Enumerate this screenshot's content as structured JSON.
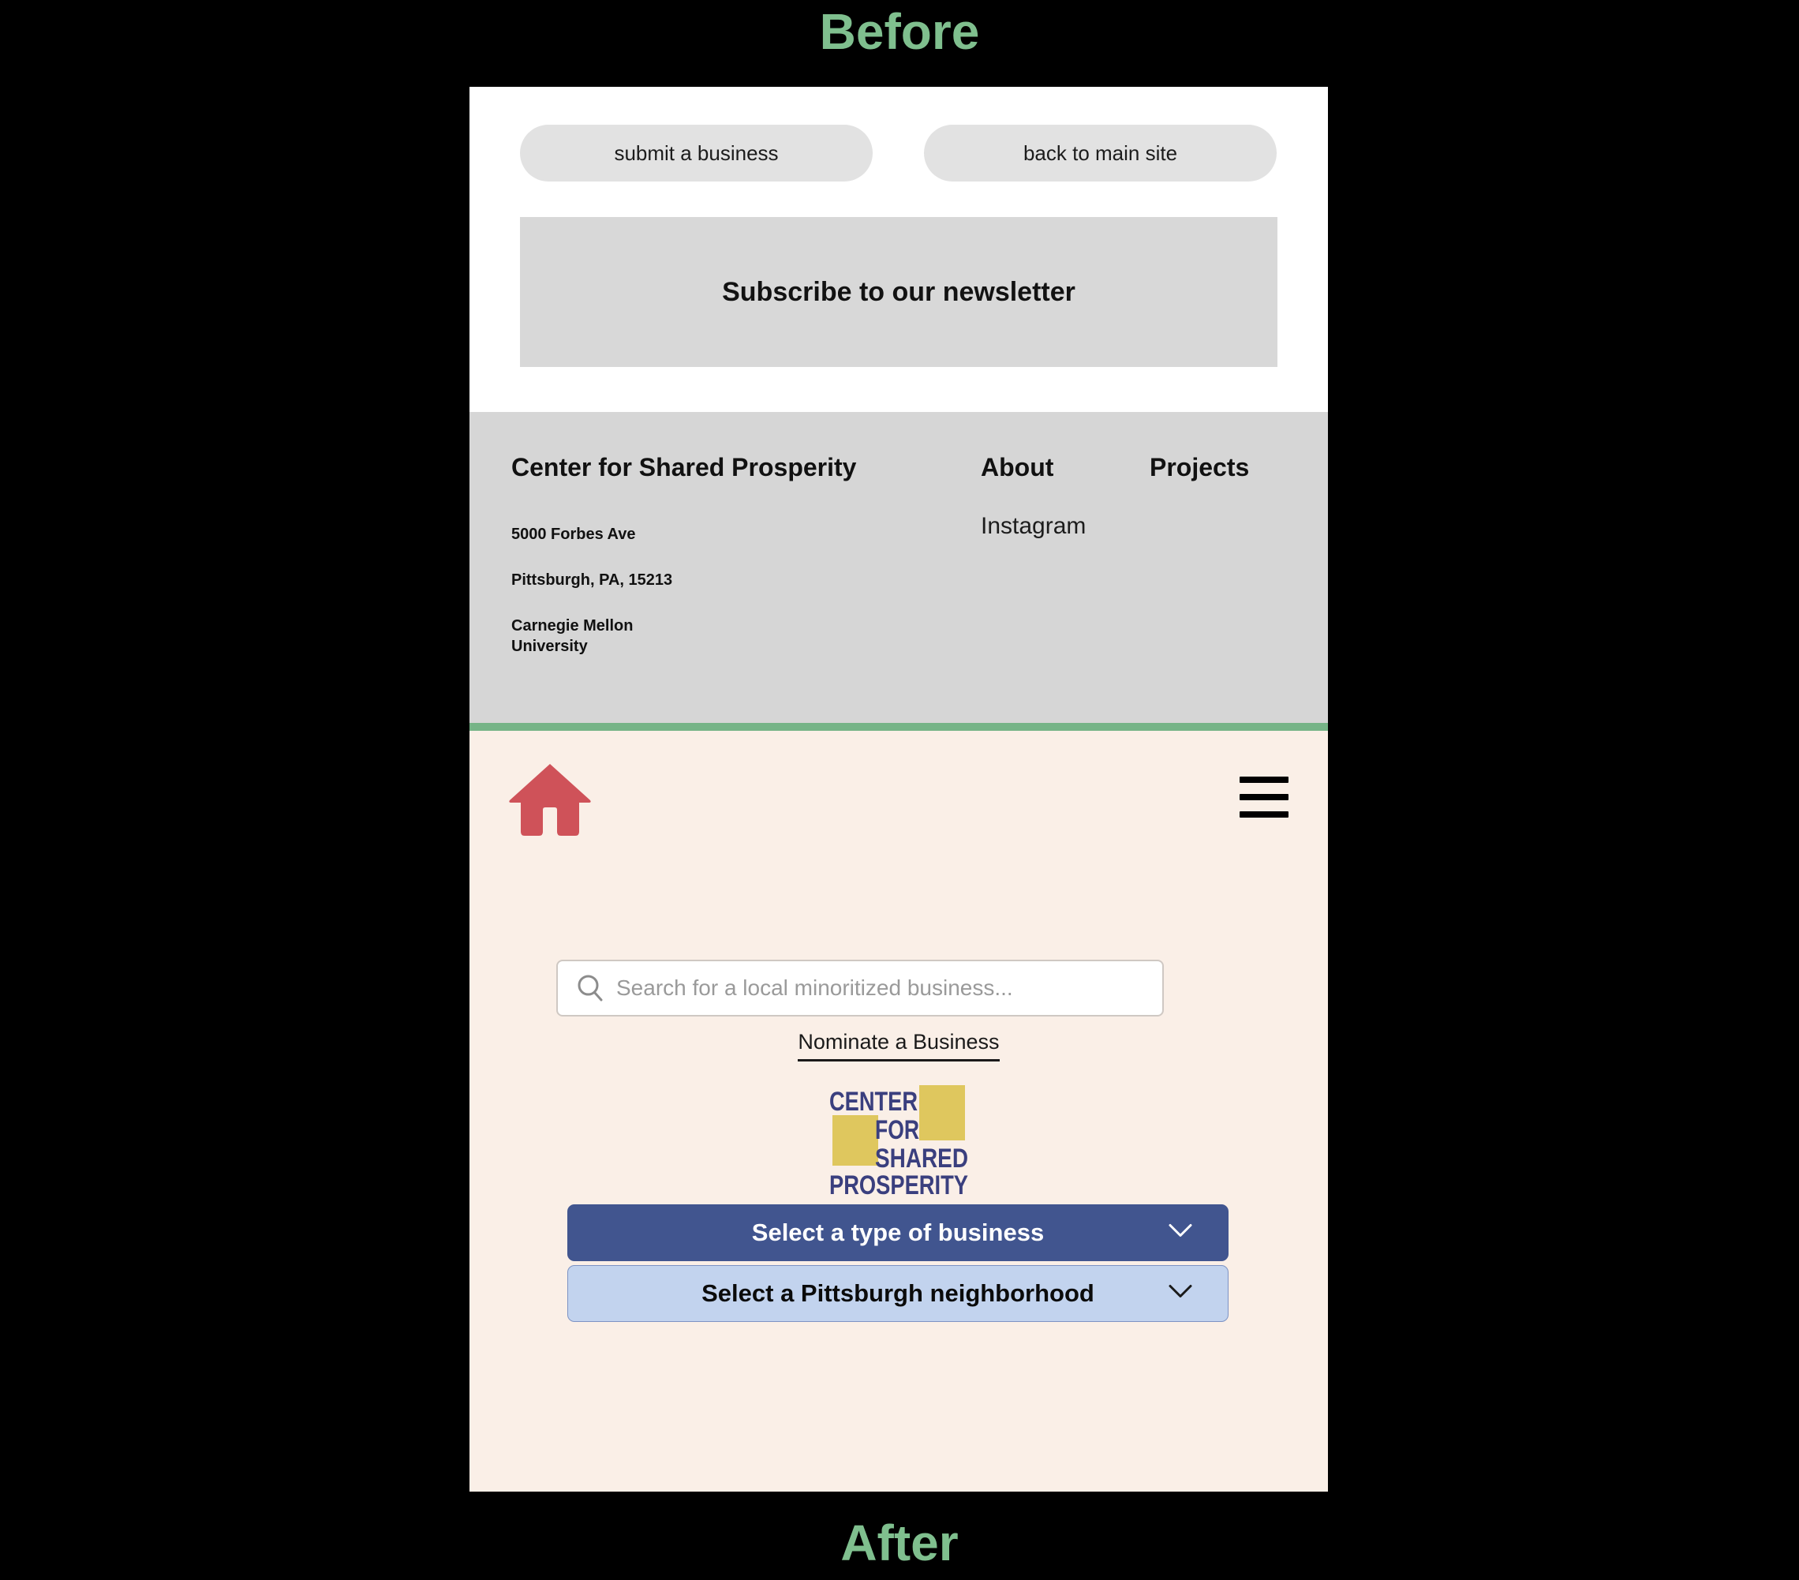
{
  "labels": {
    "before": "Before",
    "after": "After"
  },
  "colors": {
    "caption_green": "#7FBF8E",
    "divider_green": "#76B487",
    "cream_bg": "#FAEFE7",
    "footer_gray": "#D6D6D6",
    "pill_gray": "#E2E2E2",
    "newsletter_gray": "#D8D8D8",
    "home_icon_red": "#CF5259",
    "logo_navy": "#3A3F7E",
    "logo_gold": "#DFC75E",
    "select_type_blue": "#41558F",
    "select_hood_blue": "#C2D3EE"
  },
  "before_screen": {
    "buttons": [
      {
        "id": "submit-a-business",
        "label": "submit a business"
      },
      {
        "id": "back-to-main-site",
        "label": "back to main site"
      }
    ],
    "newsletter": {
      "label": "Subscribe to our newsletter"
    },
    "footer": {
      "brand": "Center for Shared Prosperity",
      "address": [
        "5000 Forbes Ave",
        "Pittsburgh, PA, 15213",
        "Carnegie Mellon University"
      ],
      "nav": [
        {
          "id": "about",
          "label": "About"
        },
        {
          "id": "projects",
          "label": "Projects"
        }
      ],
      "social": [
        {
          "id": "instagram",
          "label": "Instagram"
        }
      ]
    }
  },
  "after_screen": {
    "home_icon": "home-icon",
    "menu_icon": "hamburger-menu-icon",
    "search": {
      "icon": "search-icon",
      "value": "",
      "placeholder": "Search for a local minoritized business..."
    },
    "nominate_link": "Nominate a Business",
    "logo": {
      "lines": [
        "CENTER",
        "FOR",
        "SHARED",
        "PROSPERITY"
      ],
      "alt": "Center for Shared Prosperity logo"
    },
    "selects": [
      {
        "id": "type-of-business",
        "label": "Select a type of business",
        "icon": "chevron-down-icon",
        "style": "primary"
      },
      {
        "id": "pittsburgh-neighborhood",
        "label": "Select a Pittsburgh neighborhood",
        "icon": "chevron-down-icon",
        "style": "secondary"
      }
    ]
  }
}
